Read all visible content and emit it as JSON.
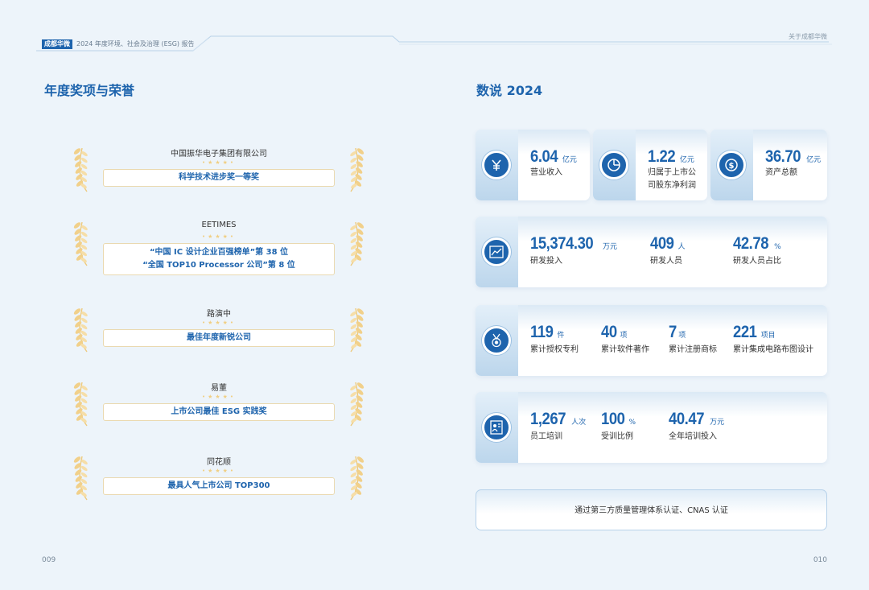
{
  "header": {
    "brand": "成都华微",
    "report_title": "2024 年度环境、社会及治理 (ESG) 报告",
    "right_title": "关于成都华微"
  },
  "left": {
    "section_title": "年度奖项与荣誉",
    "awards": [
      {
        "org": "中国振华电子集团有限公司",
        "lines": [
          "科学技术进步奖一等奖"
        ]
      },
      {
        "org": "EETIMES",
        "lines": [
          "“中国 IC 设计企业百强榜单”第 38 位",
          "“全国 TOP10 Processor 公司”第 8 位"
        ]
      },
      {
        "org": "路演中",
        "lines": [
          "最佳年度新锐公司"
        ]
      },
      {
        "org": "易董",
        "lines": [
          "上市公司最佳 ESG 实践奖"
        ]
      },
      {
        "org": "同花顺",
        "lines": [
          "最具人气上市公司 TOP300"
        ]
      }
    ],
    "page_number": "009"
  },
  "right": {
    "section_title": "数说 2024",
    "finance": [
      {
        "icon": "yen-icon",
        "value": "6.04",
        "unit": "亿元",
        "label": [
          "营业收入"
        ]
      },
      {
        "icon": "pie-chart-icon",
        "value": "1.22",
        "unit": "亿元",
        "label": [
          "归属于上市公",
          "司股东净利润"
        ]
      },
      {
        "icon": "dollar-icon",
        "value": "36.70",
        "unit": "亿元",
        "label": [
          "资产总额"
        ]
      }
    ],
    "rd": {
      "icon": "growth-chart-icon",
      "stats": [
        {
          "value": "15,374.30",
          "unit": "万元",
          "label": "研发投入"
        },
        {
          "value": "409",
          "unit": "人",
          "label": "研发人员"
        },
        {
          "value": "42.78",
          "unit": "%",
          "label": "研发人员占比"
        }
      ]
    },
    "ip": {
      "icon": "medal-icon",
      "stats": [
        {
          "value": "119",
          "unit": "件",
          "label": "累计授权专利"
        },
        {
          "value": "40",
          "unit": "项",
          "label": "累计软件著作"
        },
        {
          "value": "7",
          "unit": "项",
          "label": "累计注册商标"
        },
        {
          "value": "221",
          "unit": "项目",
          "label": "累计集成电路布图设计"
        }
      ]
    },
    "training": {
      "icon": "training-board-icon",
      "stats": [
        {
          "value": "1,267",
          "unit": "人次",
          "label": "员工培训"
        },
        {
          "value": "100",
          "unit": "%",
          "label": "受训比例"
        },
        {
          "value": "40.47",
          "unit": "万元",
          "label": "全年培训投入"
        }
      ]
    },
    "certification": "通过第三方质量管理体系认证、CNAS 认证",
    "page_number": "010"
  }
}
